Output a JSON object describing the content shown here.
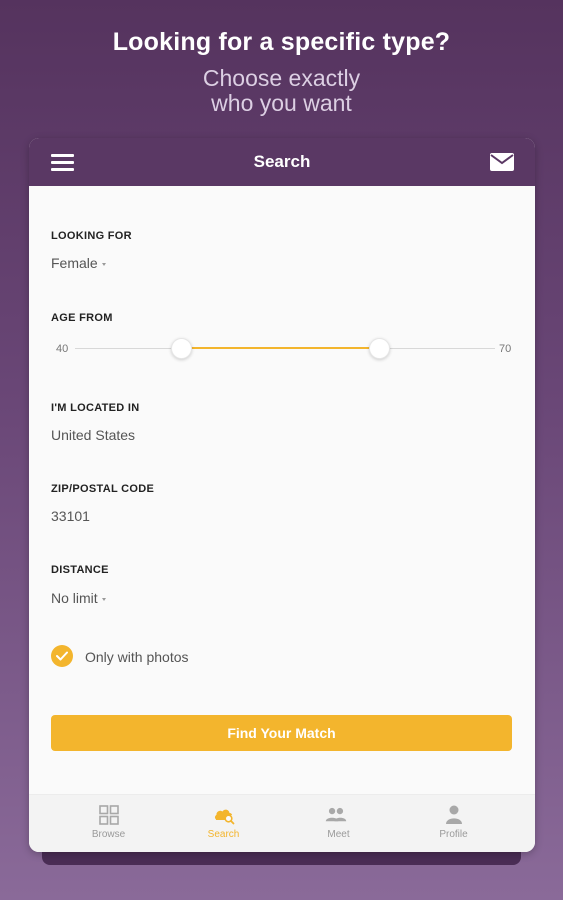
{
  "promo": {
    "headline": "Looking for a specific type?",
    "subline_1": "Choose exactly",
    "subline_2": "who you want"
  },
  "appbar": {
    "title": "Search",
    "menu_icon": "hamburger-menu-icon",
    "mail_icon": "mail-icon"
  },
  "form": {
    "looking_for": {
      "label": "LOOKING FOR",
      "value": "Female"
    },
    "age": {
      "label": "AGE FROM",
      "min": "40",
      "max": "70"
    },
    "location": {
      "label": "I'M LOCATED IN",
      "value": "United States"
    },
    "zip": {
      "label": "ZIP/POSTAL CODE",
      "value": "33101"
    },
    "distance": {
      "label": "DISTANCE",
      "value": "No limit"
    },
    "photos": {
      "label": "Only with photos",
      "checked": true
    },
    "submit_label": "Find Your Match"
  },
  "bottom_nav": [
    {
      "label": "Browse",
      "icon": "grid-icon",
      "active": false
    },
    {
      "label": "Search",
      "icon": "search-cloud-icon",
      "active": true
    },
    {
      "label": "Meet",
      "icon": "people-icon",
      "active": false
    },
    {
      "label": "Profile",
      "icon": "person-icon",
      "active": false
    }
  ],
  "colors": {
    "accent": "#f3b52d",
    "appbar": "#5a3864",
    "background_top": "#55335e",
    "background_bottom": "#8a6a99"
  }
}
